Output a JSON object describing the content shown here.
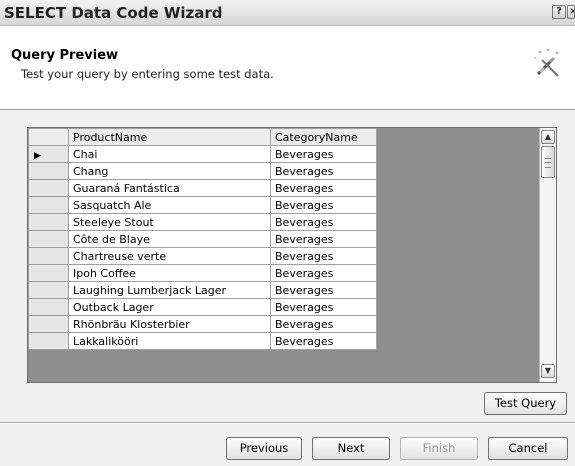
{
  "window": {
    "title": "SELECT Data Code Wizard",
    "help_glyph": "?",
    "close_glyph": "×"
  },
  "header": {
    "title": "Query Preview",
    "subtitle": "Test your query by entering some test data."
  },
  "grid": {
    "columns": [
      "ProductName",
      "CategoryName"
    ],
    "current_row_marker": "▶",
    "rows": [
      [
        "Chai",
        "Beverages"
      ],
      [
        "Chang",
        "Beverages"
      ],
      [
        "Guaraná Fantástica",
        "Beverages"
      ],
      [
        "Sasquatch Ale",
        "Beverages"
      ],
      [
        "Steeleye Stout",
        "Beverages"
      ],
      [
        "Côte de Blaye",
        "Beverages"
      ],
      [
        "Chartreuse verte",
        "Beverages"
      ],
      [
        "Ipoh Coffee",
        "Beverages"
      ],
      [
        "Laughing Lumberjack Lager",
        "Beverages"
      ],
      [
        "Outback Lager",
        "Beverages"
      ],
      [
        "Rhönbräu Klosterbier",
        "Beverages"
      ],
      [
        "Lakkalikööri",
        "Beverages"
      ]
    ],
    "scroll_up_glyph": "▲",
    "scroll_down_glyph": "▼"
  },
  "buttons": {
    "test_query": "Test Query",
    "previous": "Previous",
    "next": "Next",
    "finish": "Finish",
    "cancel": "Cancel"
  },
  "colors": {
    "grid_background": "#8e8e8e",
    "header_background": "#ffffff",
    "dialog_background": "#f0f0f0"
  }
}
